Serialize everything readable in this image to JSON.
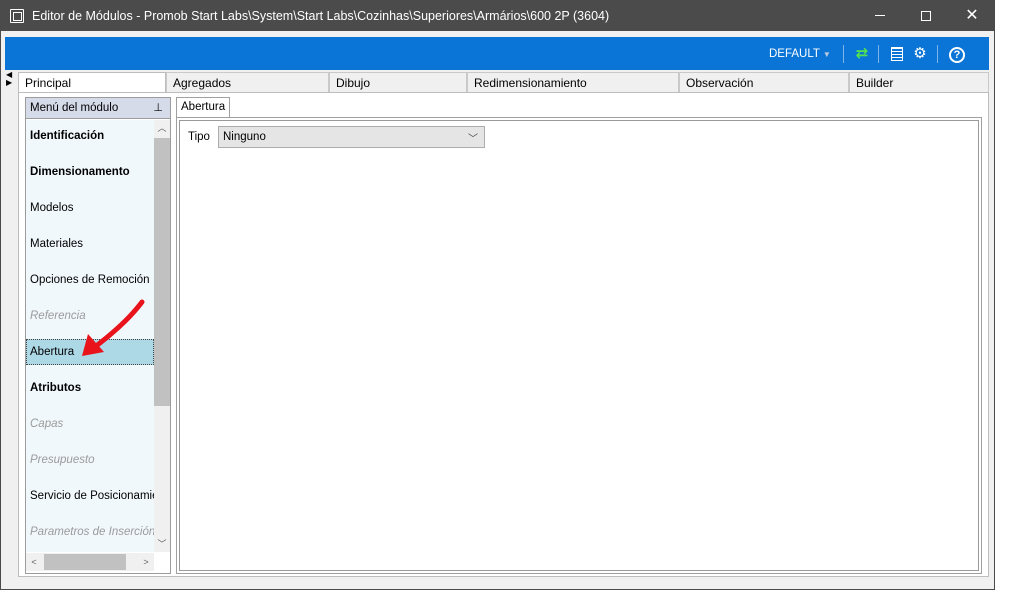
{
  "window": {
    "title": "Editor de Módulos - Promob Start Labs\\System\\Start Labs\\Cozinhas\\Superiores\\Armários\\600 2P (3604)"
  },
  "toolbar": {
    "profile": "DEFAULT",
    "icons": [
      "refresh-icon",
      "table-icon",
      "gears-icon",
      "help-icon"
    ],
    "help_glyph": "?"
  },
  "tabs": [
    {
      "label": "Principal",
      "active": true
    },
    {
      "label": "Agregados"
    },
    {
      "label": "Dibujo"
    },
    {
      "label": "Redimensionamiento"
    },
    {
      "label": "Observación"
    },
    {
      "label": "Builder"
    }
  ],
  "sidebar": {
    "header": "Menú del módulo",
    "items": [
      {
        "label": "Identificación",
        "style": "bold"
      },
      {
        "label": "Dimensionamento",
        "style": "bold"
      },
      {
        "label": "Modelos",
        "style": "normal"
      },
      {
        "label": "Materiales",
        "style": "normal"
      },
      {
        "label": "Opciones de Remoción",
        "style": "normal"
      },
      {
        "label": "Referencia",
        "style": "disabled"
      },
      {
        "label": "Abertura",
        "style": "selected"
      },
      {
        "label": "Atributos",
        "style": "bold"
      },
      {
        "label": "Capas",
        "style": "disabled"
      },
      {
        "label": "Presupuesto",
        "style": "disabled"
      },
      {
        "label": "Servicio de Posicionamie",
        "style": "normal"
      },
      {
        "label": "Parametros de Inserción",
        "style": "disabled"
      }
    ]
  },
  "panel": {
    "subtab": "Abertura",
    "tipo_label": "Tipo",
    "tipo_value": "Ninguno"
  },
  "colors": {
    "titlebar": "#4b4b4b",
    "toolbar_blue": "#0a75d6",
    "selected_item": "#add8e6",
    "annotation_arrow": "#e8131b"
  }
}
